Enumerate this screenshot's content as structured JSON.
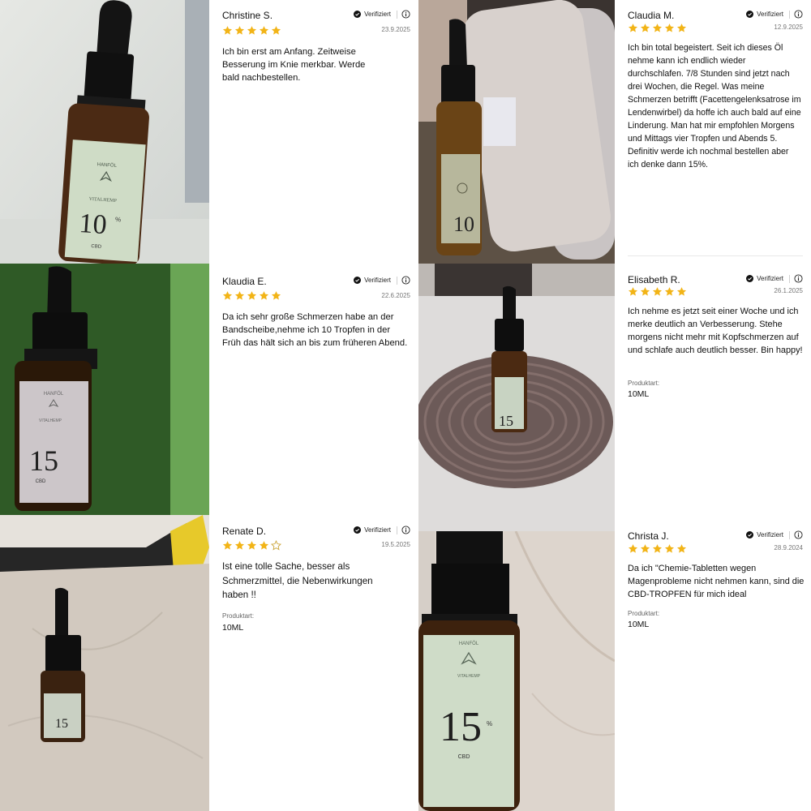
{
  "verified_label": "Verifiziert",
  "product_label": "Produktart:",
  "colors": {
    "star": "#f2b417",
    "star_empty": "#c9a233",
    "text": "#111111",
    "muted": "#777777"
  },
  "reviews": [
    {
      "name": "Christine S.",
      "date": "23.9.2025",
      "stars": 5,
      "text": "Ich bin erst am Anfang. Zeitweise Besserung im Knie merkbar. Werde bald nachbestellen.",
      "product": ""
    },
    {
      "name": "Claudia M.",
      "date": "12.9.2025",
      "stars": 5,
      "text": "Ich bin total begeistert. Seit ich dieses Öl nehme kann ich endlich wieder durchschlafen. 7/8 Stunden sind jetzt nach drei Wochen, die Regel. Was meine Schmerzen betrifft (Facettengelenksatrose im Lendenwirbel) da hoffe ich auch bald auf eine Linderung. Man hat mir empfohlen Morgens und Mittags vier Tropfen und Abends 5. Definitiv werde ich nochmal bestellen aber ich denke dann 15%.",
      "product": ""
    },
    {
      "name": "Klaudia E.",
      "date": "22.6.2025",
      "stars": 5,
      "text": "Da ich sehr große Schmerzen habe an der Bandscheibe,nehme ich 10 Tropfen in der Früh das hält sich an bis zum früheren Abend.",
      "product": ""
    },
    {
      "name": "Elisabeth R.",
      "date": "26.1.2025",
      "stars": 5,
      "text": "Ich nehme es jetzt seit einer Woche und ich merke deutlich an Verbesserung. Stehe morgens nicht mehr mit Kopfschmerzen auf und schlafe auch deutlich besser. Bin happy!",
      "product": "10ML"
    },
    {
      "name": "Renate D.",
      "date": "19.5.2025",
      "stars": 4,
      "text": "Ist eine tolle Sache, besser als Schmerzmittel, die Nebenwirkungen haben !!",
      "product": "10ML"
    },
    {
      "name": "Christa J.",
      "date": "28.9.2024",
      "stars": 5,
      "text": "Da ich \"Chemie-Tabletten wegen Magenprobleme nicht nehmen kann, sind die CBD-TROPFEN für mich  ideal",
      "product": "10ML"
    }
  ],
  "photos": [
    {
      "label_percent": "10",
      "label_brand": "HANFÖL",
      "label_sub": "VITALHEMP",
      "label_cbd": "CBD"
    },
    {
      "label_percent": "10"
    },
    {
      "label_percent": "15",
      "label_brand": "HANFÖL",
      "label_sub": "VITALHEMP",
      "label_cbd": "CBD"
    },
    {
      "label_percent": "15"
    },
    {
      "label_percent": "15"
    },
    {
      "label_percent": "15",
      "label_brand": "HANFÖL",
      "label_sub": "VITALHEMP",
      "label_cbd": "CBD"
    }
  ]
}
